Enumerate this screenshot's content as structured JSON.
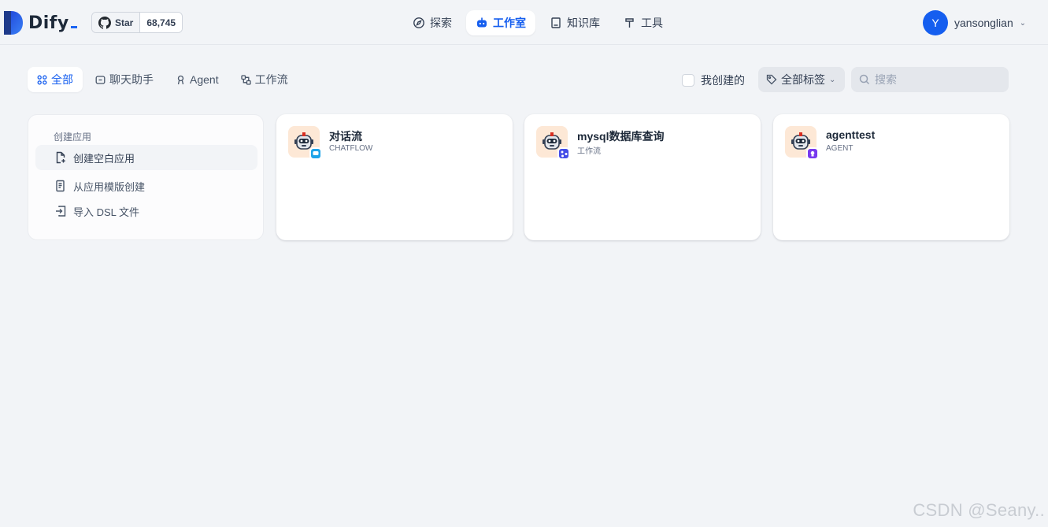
{
  "header": {
    "logo_text": "Dify",
    "github": {
      "star_label": "Star",
      "star_count": "68,745"
    },
    "nav": [
      {
        "label": "探索",
        "icon": "compass-icon",
        "active": false
      },
      {
        "label": "工作室",
        "icon": "robot-icon",
        "active": true
      },
      {
        "label": "知识库",
        "icon": "book-icon",
        "active": false
      },
      {
        "label": "工具",
        "icon": "hammer-icon",
        "active": false
      }
    ],
    "user": {
      "initial": "Y",
      "name": "yansonglian"
    }
  },
  "filters": {
    "tabs": [
      {
        "label": "全部",
        "icon": "grid-icon",
        "active": true
      },
      {
        "label": "聊天助手",
        "icon": "chat-icon",
        "active": false
      },
      {
        "label": "Agent",
        "icon": "agent-icon",
        "active": false
      },
      {
        "label": "工作流",
        "icon": "workflow-icon",
        "active": false
      }
    ],
    "created_by_me": "我创建的",
    "tag_select": "全部标签",
    "search_placeholder": "搜索"
  },
  "create_card": {
    "title": "创建应用",
    "options": [
      {
        "label": "创建空白应用",
        "icon": "file-plus-icon"
      },
      {
        "label": "从应用模版创建",
        "icon": "template-icon"
      },
      {
        "label": "导入 DSL 文件",
        "icon": "import-icon"
      }
    ]
  },
  "apps": [
    {
      "name": "对话流",
      "type": "CHATFLOW",
      "badge_color": "#1ea4e9"
    },
    {
      "name": "mysql数据库查询",
      "type": "工作流",
      "badge_color": "#444ce7"
    },
    {
      "name": "agenttest",
      "type": "AGENT",
      "badge_color": "#7839ee"
    }
  ],
  "watermark": "CSDN @Seany..",
  "colors": {
    "accent": "#155eef",
    "background": "#f2f4f7"
  }
}
